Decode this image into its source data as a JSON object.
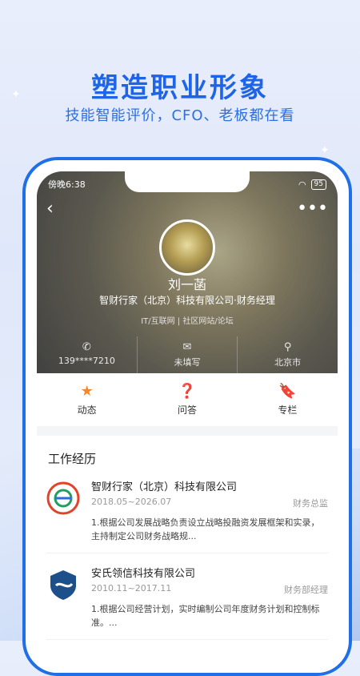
{
  "banner": {
    "headline": "塑造职业形象",
    "subline": "技能智能评价，CFO、老板都在看"
  },
  "status_bar": {
    "time": "傍晚6:38",
    "battery": "95"
  },
  "profile": {
    "name": "刘一菡",
    "company_title": "智财行家（北京）科技有限公司·财务经理",
    "industry": "IT/互联网 | 社区网站/论坛",
    "contacts": [
      {
        "icon": "phone-icon",
        "label": "139****7210"
      },
      {
        "icon": "mail-icon",
        "label": "未填写"
      },
      {
        "icon": "location-icon",
        "label": "北京市"
      }
    ]
  },
  "tabs": [
    {
      "icon": "star-icon",
      "label": "动态",
      "color": "#f5872a"
    },
    {
      "icon": "question-icon",
      "label": "问答",
      "color": "#f5a623"
    },
    {
      "icon": "bookmark-icon",
      "label": "专栏",
      "color": "#2f80ed"
    }
  ],
  "work": {
    "title": "工作经历",
    "items": [
      {
        "company": "智财行家（北京）科技有限公司",
        "period": "2018.05~2026.07",
        "role": "财务总监",
        "desc": "1.根据公司发展战略负责设立战略投融资发展框架和实录，主持制定公司财务战略规..."
      },
      {
        "company": "安氏领信科技有限公司",
        "period": "2010.11~2017.11",
        "role": "财务部经理",
        "desc": "1.根据公司经营计划，实时编制公司年度财务计划和控制标准。..."
      }
    ]
  }
}
